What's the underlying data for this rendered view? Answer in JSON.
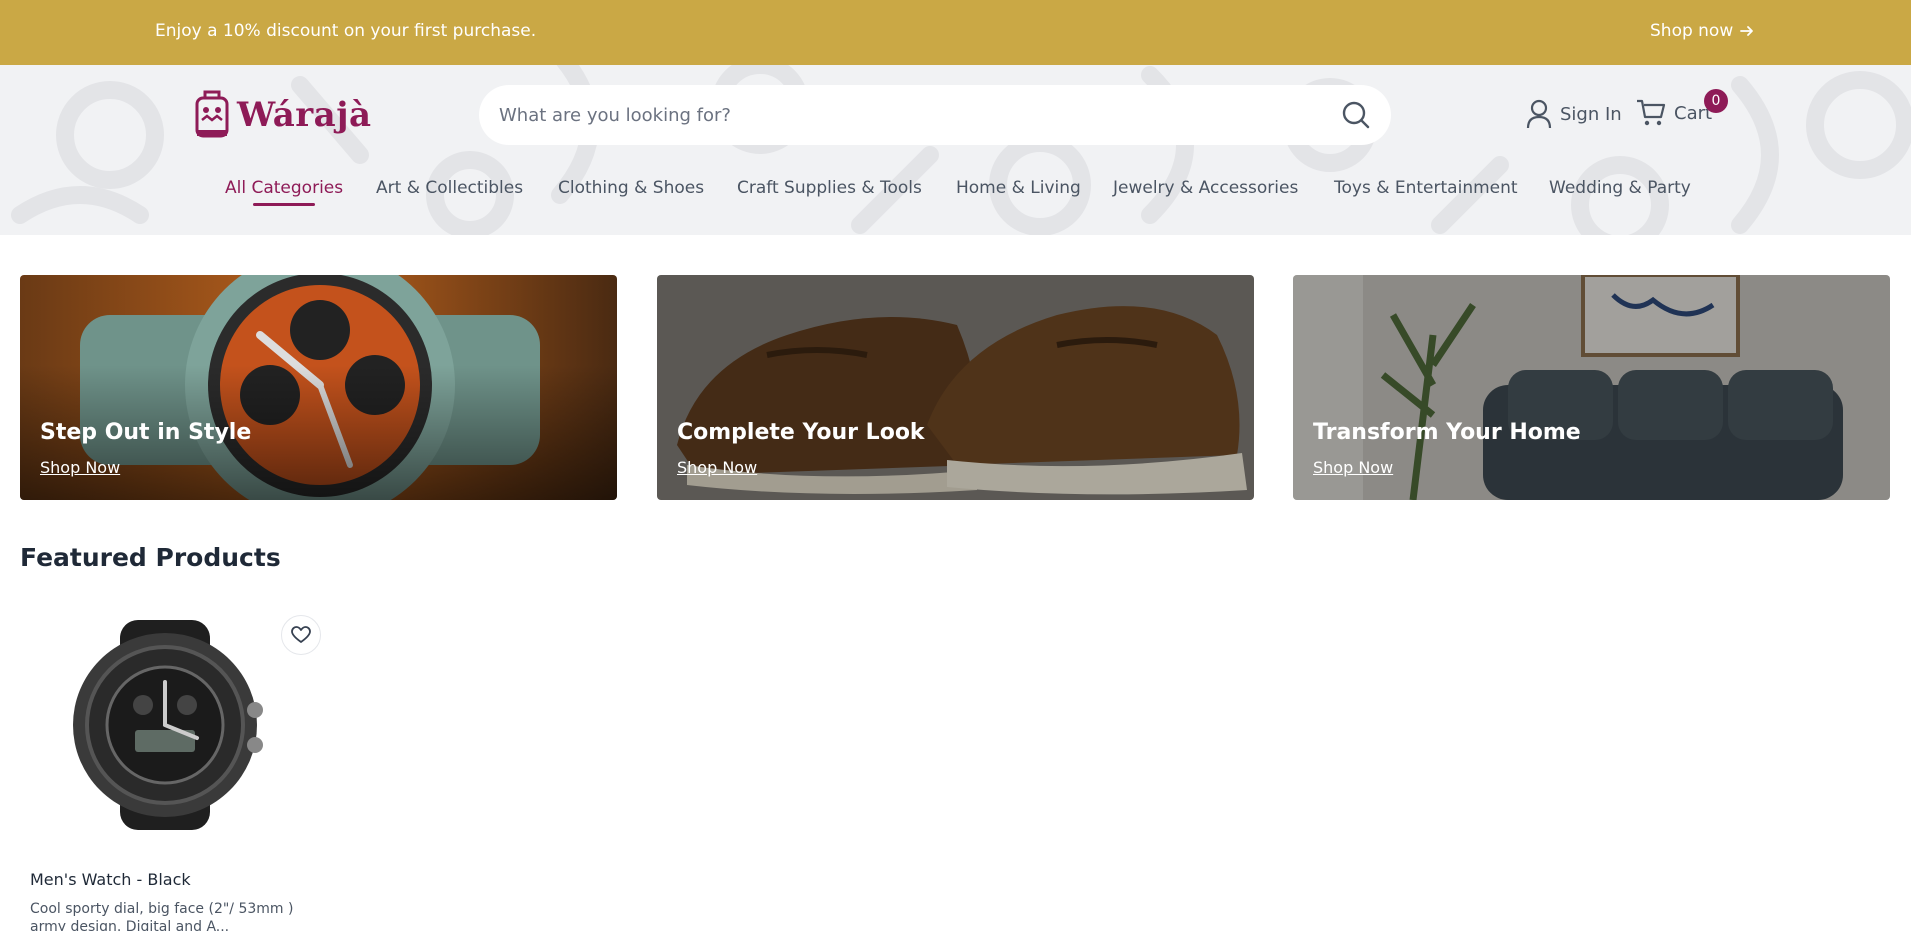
{
  "promo": {
    "text": "Enjoy a 10% discount on your first purchase.",
    "link_label": "Shop now"
  },
  "header": {
    "logo_text": "Wárajà",
    "search_placeholder": "What are you looking for?",
    "signin_label": "Sign In",
    "cart_label": "Cart",
    "cart_count": "0"
  },
  "categories": [
    {
      "label": "All Categories",
      "active": true
    },
    {
      "label": "Art & Collectibles"
    },
    {
      "label": "Clothing & Shoes"
    },
    {
      "label": "Craft Supplies & Tools"
    },
    {
      "label": "Home & Living"
    },
    {
      "label": "Jewelry & Accessories"
    },
    {
      "label": "Toys & Entertainment"
    },
    {
      "label": "Wedding & Party"
    }
  ],
  "banners": [
    {
      "title": "Step Out in Style",
      "link_label": "Shop Now"
    },
    {
      "title": "Complete Your Look",
      "link_label": "Shop Now"
    },
    {
      "title": "Transform Your Home",
      "link_label": "Shop Now"
    }
  ],
  "featured": {
    "title": "Featured Products",
    "products": [
      {
        "name": "Men's Watch - Black",
        "description": "Cool sporty dial, big face (2\"/ 53mm ) army design. Digital and A..."
      }
    ]
  },
  "colors": {
    "promo_bg": "#caa845",
    "brand": "#8e1b57",
    "header_bg": "#f1f2f4"
  }
}
